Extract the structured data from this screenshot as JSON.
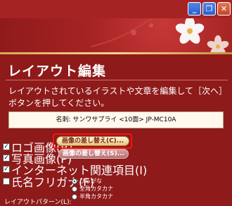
{
  "window": {
    "controls": {
      "minimize": "_",
      "restore": "❐",
      "close": "✕"
    }
  },
  "page": {
    "title": "レイアウト編集",
    "description": "レイアウトされているイラストや文章を編集して［次へ］ボタンを押してください。"
  },
  "name_box": {
    "text": "名刺: サンワサプライ <10面> JP-MC10A"
  },
  "options": [
    {
      "label": "ロゴ画像(R)",
      "checked": true,
      "button": "画像の差し替え(C)...",
      "button_enabled": true
    },
    {
      "label": "写真画像(P)",
      "checked": true,
      "button": "画像の差し替え(S)...",
      "button_enabled": false
    },
    {
      "label": "インターネット関連項目(I)",
      "checked": true
    },
    {
      "label": "氏名フリガナ(F)",
      "checked": false
    }
  ],
  "furigana": [
    {
      "label": "ひらがな",
      "selected": true
    },
    {
      "label": "全角カタカナ",
      "selected": false
    },
    {
      "label": "半角カタカナ",
      "selected": false
    }
  ],
  "layout_pattern": {
    "label": "レイアウトパターン(L):"
  },
  "colors": {
    "background": "#8e1a1a",
    "highlight": "#ff1010"
  }
}
